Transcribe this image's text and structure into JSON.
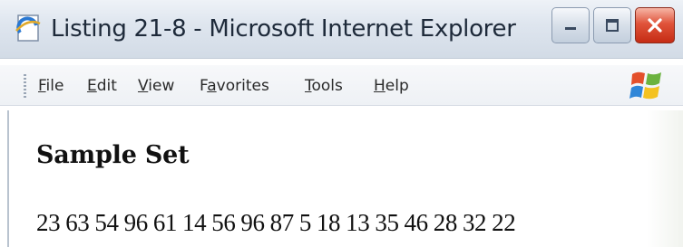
{
  "window": {
    "title": "Listing 21-8 - Microsoft Internet Explorer",
    "controls": {
      "minimize": "minimize",
      "maximize": "maximize",
      "close": "close"
    }
  },
  "menubar": {
    "items": [
      {
        "label": "File",
        "accel": "F"
      },
      {
        "label": "Edit",
        "accel": "E"
      },
      {
        "label": "View",
        "accel": "V"
      },
      {
        "label": "Favorites",
        "accel": "a"
      },
      {
        "label": "Tools",
        "accel": "T"
      },
      {
        "label": "Help",
        "accel": "H"
      }
    ]
  },
  "page": {
    "heading": "Sample Set",
    "numbers": [
      "23",
      "63",
      "54",
      "96",
      "61",
      "14",
      "56",
      "96",
      "87",
      "5",
      "18",
      "13",
      "35",
      "46",
      "28",
      "32",
      "22"
    ]
  },
  "colors": {
    "titlebar": "#dfe6ef",
    "close_button": "#e0533a",
    "text": "#111111"
  },
  "icons": {
    "title": "ie-page-icon",
    "logo": "windows-logo-icon"
  }
}
